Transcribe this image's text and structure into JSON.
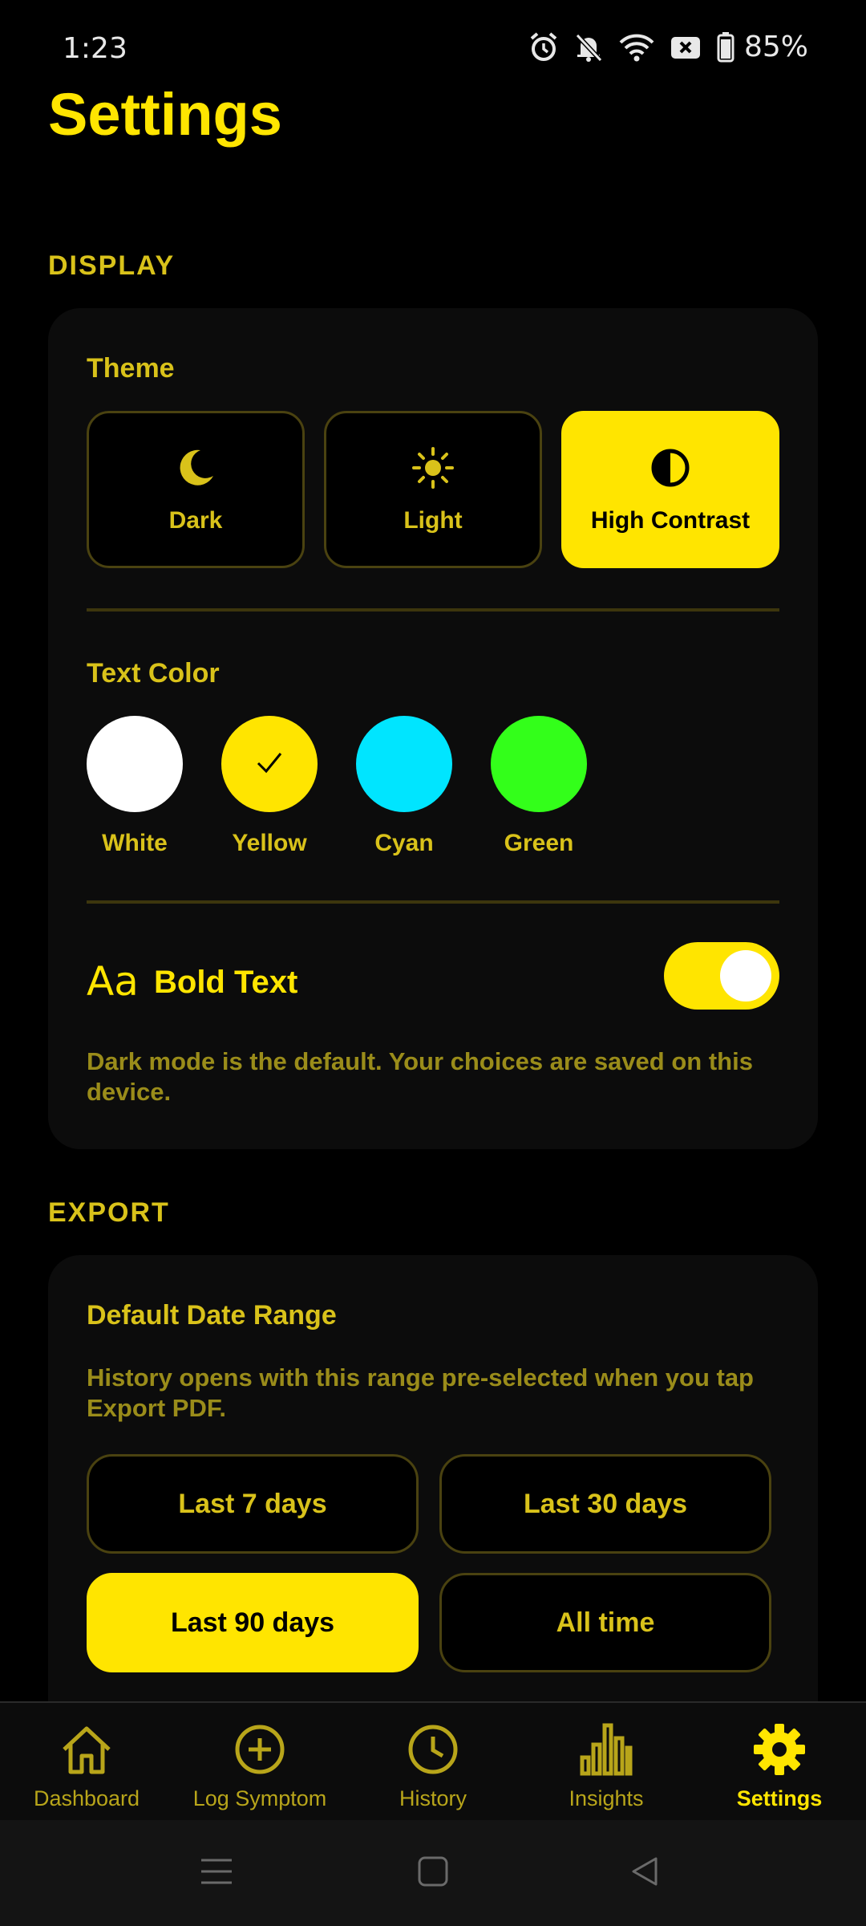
{
  "status_bar": {
    "time": "1:23",
    "battery_percent": "85%",
    "icons": [
      "alarm-icon",
      "bell-off-icon",
      "wifi-icon",
      "notification-x-icon",
      "battery-icon"
    ]
  },
  "page_title": "Settings",
  "display": {
    "section_label": "DISPLAY",
    "theme": {
      "heading": "Theme",
      "options": [
        {
          "label": "Dark",
          "icon": "moon-icon",
          "selected": false
        },
        {
          "label": "Light",
          "icon": "sun-icon",
          "selected": false
        },
        {
          "label": "High Contrast",
          "icon": "contrast-icon",
          "selected": true
        }
      ]
    },
    "text_color": {
      "heading": "Text Color",
      "options": [
        {
          "label": "White",
          "color": "#FFFFFF",
          "selected": false
        },
        {
          "label": "Yellow",
          "color": "#FFE500",
          "selected": true
        },
        {
          "label": "Cyan",
          "color": "#00E5FF",
          "selected": false
        },
        {
          "label": "Green",
          "color": "#33FF1A",
          "selected": false
        }
      ]
    },
    "bold_text": {
      "icon_glyph": "Aa",
      "label": "Bold Text",
      "enabled": true
    },
    "note": "Dark mode is the default. Your choices are saved on this device."
  },
  "export": {
    "section_label": "EXPORT",
    "default_range": {
      "heading": "Default Date Range",
      "description": "History opens with this range pre-selected when you tap Export PDF.",
      "options": [
        {
          "label": "Last 7 days",
          "selected": false
        },
        {
          "label": "Last 30 days",
          "selected": false
        },
        {
          "label": "Last 90 days",
          "selected": true
        },
        {
          "label": "All time",
          "selected": false
        }
      ]
    }
  },
  "bottom_nav": {
    "items": [
      {
        "label": "Dashboard",
        "icon": "home-icon",
        "active": false
      },
      {
        "label": "Log Symptom",
        "icon": "plus-circle-icon",
        "active": false
      },
      {
        "label": "History",
        "icon": "clock-icon",
        "active": false
      },
      {
        "label": "Insights",
        "icon": "bar-chart-icon",
        "active": false
      },
      {
        "label": "Settings",
        "icon": "gear-icon",
        "active": true
      }
    ]
  },
  "colors": {
    "accent": "#FFE500",
    "background": "#000000",
    "card": "#0C0C0C",
    "muted_text": "#9A8C1A"
  }
}
